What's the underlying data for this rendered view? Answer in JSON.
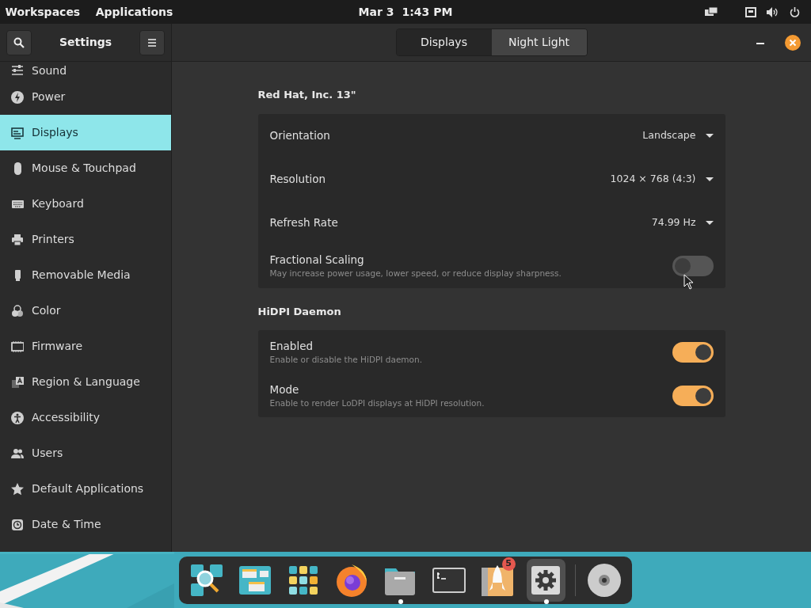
{
  "top_bar": {
    "menus": [
      "Workspaces",
      "Applications"
    ],
    "date": "Mar 3",
    "time": "1:43 PM"
  },
  "window": {
    "title": "Settings",
    "tabs": [
      {
        "label": "Displays",
        "selected": true
      },
      {
        "label": "Night Light",
        "selected": false
      }
    ]
  },
  "sidebar": {
    "items": [
      {
        "label": "Sound",
        "selected": false
      },
      {
        "label": "Power",
        "selected": false
      },
      {
        "label": "Displays",
        "selected": true
      },
      {
        "label": "Mouse & Touchpad",
        "selected": false
      },
      {
        "label": "Keyboard",
        "selected": false
      },
      {
        "label": "Printers",
        "selected": false
      },
      {
        "label": "Removable Media",
        "selected": false
      },
      {
        "label": "Color",
        "selected": false
      },
      {
        "label": "Firmware",
        "selected": false
      },
      {
        "label": "Region & Language",
        "selected": false
      },
      {
        "label": "Accessibility",
        "selected": false
      },
      {
        "label": "Users",
        "selected": false
      },
      {
        "label": "Default Applications",
        "selected": false
      },
      {
        "label": "Date & Time",
        "selected": false
      }
    ]
  },
  "sections": [
    {
      "title": "Red Hat, Inc. 13\"",
      "rows": [
        {
          "kind": "dropdown",
          "label": "Orientation",
          "value": "Landscape"
        },
        {
          "kind": "dropdown",
          "label": "Resolution",
          "value": "1024 × 768 (4:3)"
        },
        {
          "kind": "dropdown",
          "label": "Refresh Rate",
          "value": "74.99 Hz"
        },
        {
          "kind": "switch",
          "label": "Fractional Scaling",
          "description": "May increase power usage, lower speed, or reduce display sharpness.",
          "on": false
        }
      ]
    },
    {
      "title": "HiDPI Daemon",
      "rows": [
        {
          "kind": "switch",
          "label": "Enabled",
          "description": "Enable or disable the HiDPI daemon.",
          "on": true
        },
        {
          "kind": "switch",
          "label": "Mode",
          "description": "Enable to render LoDPI displays at HiDPI resolution.",
          "on": true
        }
      ]
    }
  ],
  "dock": {
    "items": [
      {
        "running": false,
        "active": false
      },
      {
        "running": false,
        "active": false
      },
      {
        "running": false,
        "active": false
      },
      {
        "running": false,
        "active": false
      },
      {
        "running": true,
        "active": false
      },
      {
        "running": false,
        "active": false
      },
      {
        "running": false,
        "active": false,
        "badge": "5"
      },
      {
        "running": true,
        "active": true
      }
    ]
  }
}
